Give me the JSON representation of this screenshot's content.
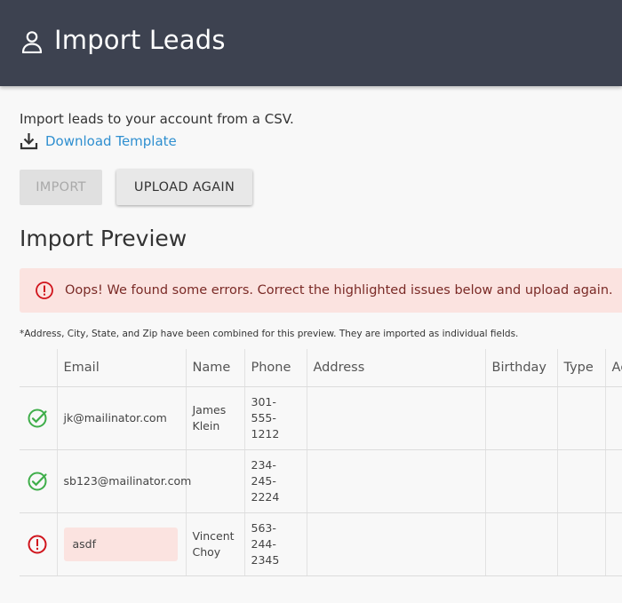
{
  "header": {
    "title": "Import Leads",
    "icon": "user-icon",
    "bg_color": "#3d4250"
  },
  "intro": {
    "text": "Import leads to your account from a CSV.",
    "download_label": "Download Template",
    "download_icon": "download-icon",
    "link_color": "#2f8fd0"
  },
  "buttons": {
    "import_label": "IMPORT",
    "import_disabled": true,
    "upload_again_label": "UPLOAD AGAIN"
  },
  "preview": {
    "title": "Import Preview",
    "error_message": "Oops! We found some errors. Correct the highlighted issues below and upload again.",
    "error_icon": "alert-circle-icon",
    "error_bg": "#fbe3e0",
    "note": "*Address, City, State, and Zip have been combined for this preview. They are imported as individual fields."
  },
  "table": {
    "columns": [
      "",
      "Email",
      "Name",
      "Phone",
      "Address",
      "Birthday",
      "Type",
      "Ag"
    ],
    "rows": [
      {
        "status": "valid",
        "status_icon": "check-circle-icon",
        "email": "jk@mailinator.com",
        "email_error": false,
        "name": "James Klein",
        "phone": "301-\n555-\n1212",
        "address": "",
        "birthday": "",
        "type": "",
        "ag": ""
      },
      {
        "status": "valid",
        "status_icon": "check-circle-icon",
        "email": "sb123@mailinator.com",
        "email_error": false,
        "name": "",
        "phone": "234-\n245-\n2224",
        "address": "",
        "birthday": "",
        "type": "",
        "ag": ""
      },
      {
        "status": "error",
        "status_icon": "alert-circle-icon",
        "email": "asdf",
        "email_error": true,
        "name": "Vincent Choy",
        "phone": "563-\n244-\n2345",
        "address": "",
        "birthday": "",
        "type": "",
        "ag": ""
      }
    ],
    "colors": {
      "valid": "#3fae4a",
      "error": "#d0141c"
    }
  }
}
